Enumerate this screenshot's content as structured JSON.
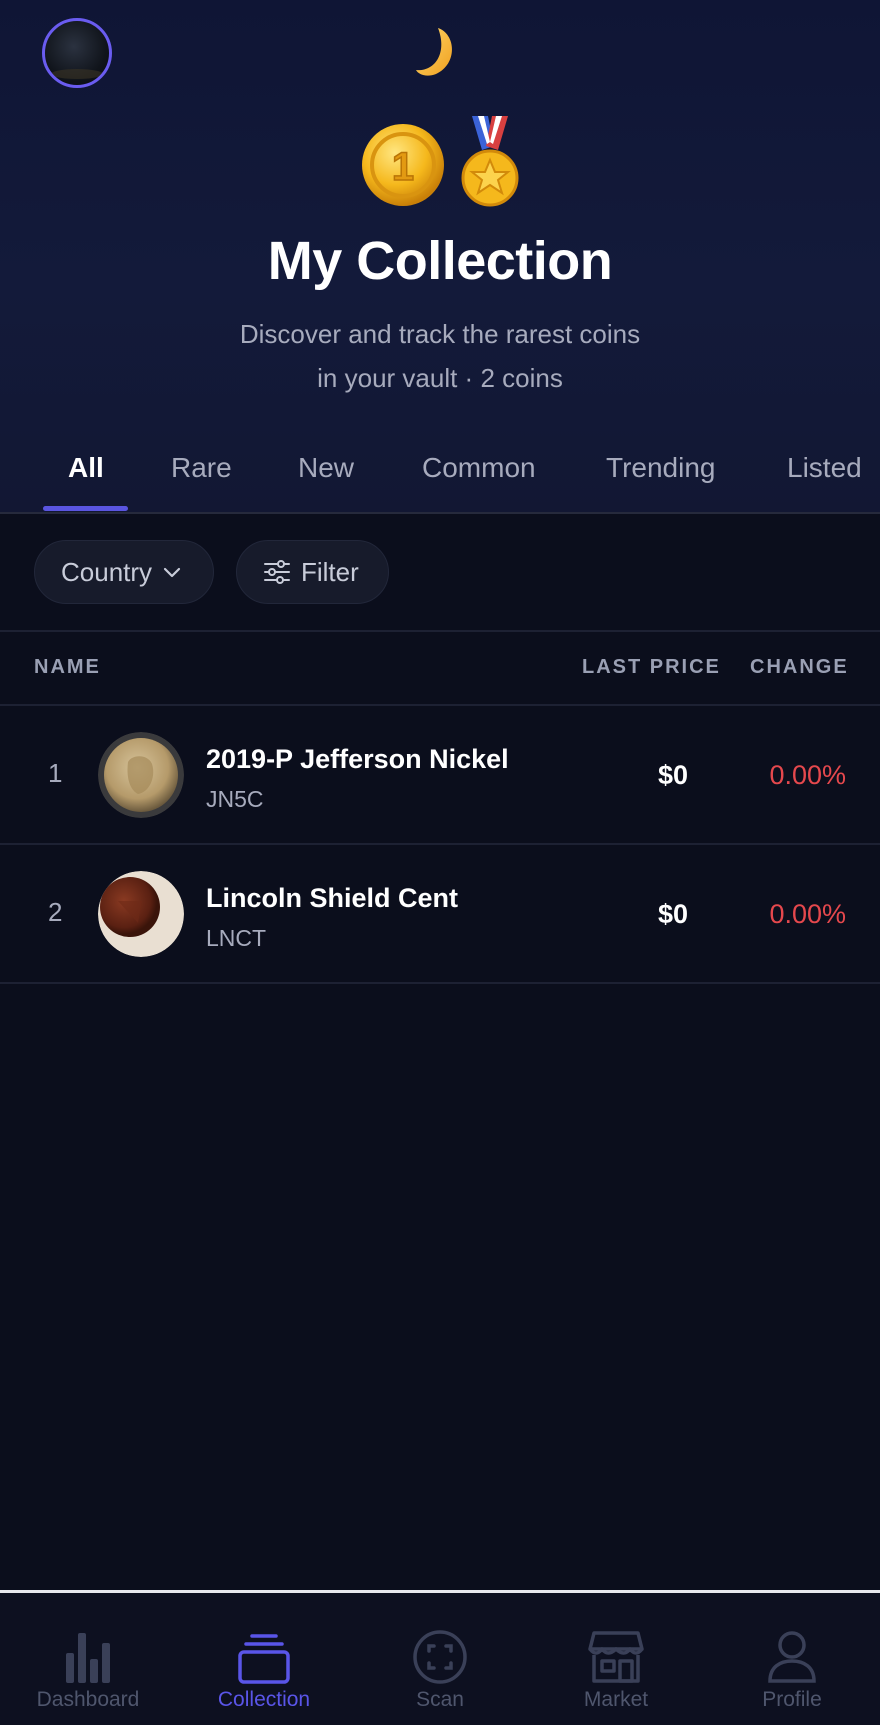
{
  "header": {
    "title": "My Collection",
    "subtitle_line1": "Discover and track the rarest coins",
    "subtitle_line2": "in your vault · 2 coins",
    "icons": [
      "avatar",
      "moon-icon",
      "coin-one-emoji",
      "medal-emoji"
    ]
  },
  "tabs": [
    {
      "label": "All",
      "active": true
    },
    {
      "label": "Rare"
    },
    {
      "label": "New"
    },
    {
      "label": "Common"
    },
    {
      "label": "Trending"
    },
    {
      "label": "Listed"
    }
  ],
  "filters": {
    "country_label": "Country",
    "filter_label": "Filter"
  },
  "table": {
    "headers": {
      "name": "NAME",
      "last_price": "LAST PRICE",
      "change": "CHANGE"
    },
    "rows": [
      {
        "rank": "1",
        "name": "2019-P Jefferson Nickel",
        "symbol": "JN5C",
        "price": "$0",
        "change": "0.00%"
      },
      {
        "rank": "2",
        "name": "Lincoln Shield Cent",
        "symbol": "LNCT",
        "price": "$0",
        "change": "0.00%"
      }
    ]
  },
  "bottom_nav": [
    {
      "label": "Dashboard",
      "icon": "bar-chart-icon"
    },
    {
      "label": "Collection",
      "icon": "stack-icon",
      "active": true
    },
    {
      "label": "Scan",
      "icon": "scan-icon"
    },
    {
      "label": "Market",
      "icon": "store-icon"
    },
    {
      "label": "Profile",
      "icon": "person-icon"
    }
  ],
  "colors": {
    "accent": "#5a55e8",
    "negative": "#e5484d",
    "background": "#0b0e1c"
  }
}
